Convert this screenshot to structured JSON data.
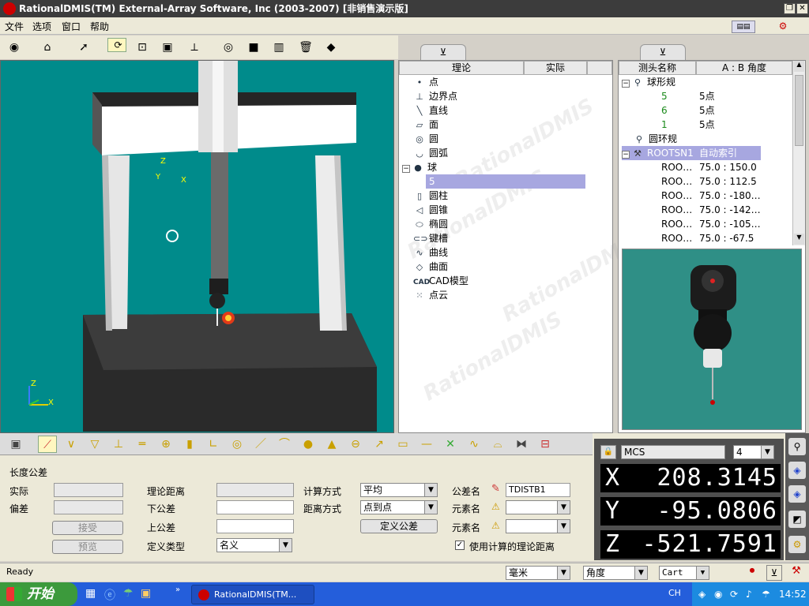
{
  "title": "RationalDMIS(TM) External-Array Software, Inc (2003-2007) [非销售演示版]",
  "menu": [
    "文件",
    "选项",
    "窗口",
    "帮助"
  ],
  "left_tab": {
    "col_theory": "理论",
    "col_actual": "实际",
    "items": [
      "点",
      "边界点",
      "直线",
      "面",
      "圆",
      "圆弧",
      "球",
      "5",
      "圆柱",
      "圆锥",
      "椭圆",
      "键槽",
      "曲线",
      "曲面",
      "CAD模型",
      "点云"
    ],
    "selected": "5"
  },
  "right_tab": {
    "col_name": "测头名称",
    "col_angle": "A : B 角度",
    "nodes": [
      {
        "label": "球形规",
        "value": ""
      },
      {
        "label": "5",
        "value": "5点"
      },
      {
        "label": "6",
        "value": "5点"
      },
      {
        "label": "1",
        "value": "5点"
      },
      {
        "label": "圆环规",
        "value": ""
      },
      {
        "label": "ROOTSN1",
        "value": "自动索引"
      },
      {
        "label": "ROO…",
        "value": "75.0 : 150.0"
      },
      {
        "label": "ROO…",
        "value": "75.0 : 112.5"
      },
      {
        "label": "ROO…",
        "value": "75.0 : -180…"
      },
      {
        "label": "ROO…",
        "value": "75.0 : -142…"
      },
      {
        "label": "ROO…",
        "value": "75.0 : -105…"
      },
      {
        "label": "ROO…",
        "value": "75.0 : -67.5"
      }
    ]
  },
  "viewport": {
    "axis_z": "Z",
    "axis_y": "Y",
    "axis_x": "X",
    "triad_z": "Z",
    "triad_x": "X"
  },
  "form": {
    "section": "长度公差",
    "actual": "实际",
    "deviation": "偏差",
    "accept": "接受",
    "preview": "预览",
    "theory_dist": "理论距离",
    "lower_tol": "下公差",
    "upper_tol": "上公差",
    "def_type": "定义类型",
    "def_type_val": "名义",
    "calc_mode": "计算方式",
    "calc_mode_val": "平均",
    "dist_mode": "距离方式",
    "dist_mode_val": "点到点",
    "define_tol": "定义公差",
    "tol_name": "公差名",
    "tol_name_val": "TDISTB1",
    "elem1": "元素名",
    "elem2": "元素名",
    "use_calc": "使用计算的理论距离"
  },
  "dro": {
    "coord": "MCS",
    "digits": "4",
    "x_label": "X",
    "x_val": "208.3145",
    "y_label": "Y",
    "y_val": "-95.0806",
    "z_label": "Z",
    "z_val": "-521.7591"
  },
  "status": {
    "text": "Ready",
    "unit": "毫米",
    "angle": "角度",
    "coordsys": "Cart"
  },
  "taskbar": {
    "start": "开始",
    "task": "RationalDMIS(TM...",
    "lang": "CH",
    "time": "14:52"
  },
  "colors": {
    "viewport": "#008b8b",
    "selection": "#a7a7e0",
    "titlebar": "#3c3c3c",
    "taskbar": "#245edb"
  }
}
